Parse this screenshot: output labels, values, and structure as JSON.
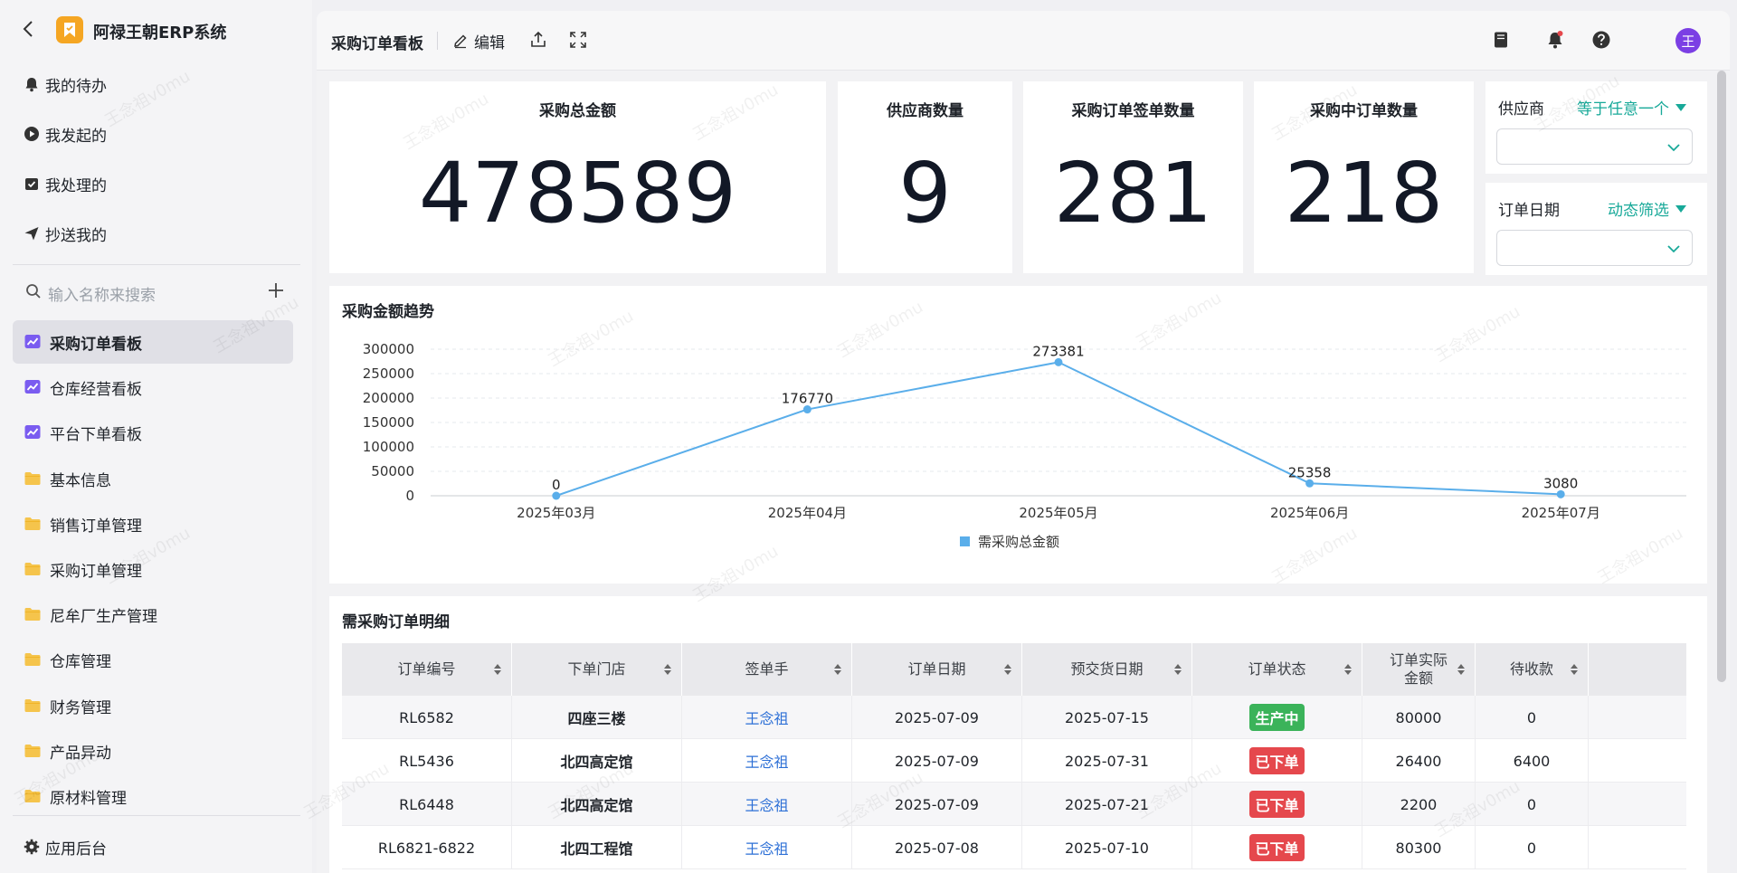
{
  "app": {
    "title": "阿禄王朝ERP系统"
  },
  "sidebar": {
    "quick": [
      {
        "label": "我的待办",
        "icon": "bell-icon"
      },
      {
        "label": "我发起的",
        "icon": "play-circle-icon"
      },
      {
        "label": "我处理的",
        "icon": "check-box-icon"
      },
      {
        "label": "抄送我的",
        "icon": "send-icon"
      }
    ],
    "search_placeholder": "输入名称来搜索",
    "items": [
      {
        "label": "采购订单看板",
        "icon": "dashboard-icon",
        "active": true
      },
      {
        "label": "仓库经营看板",
        "icon": "dashboard-icon"
      },
      {
        "label": "平台下单看板",
        "icon": "dashboard-icon"
      },
      {
        "label": "基本信息",
        "icon": "folder-icon"
      },
      {
        "label": "销售订单管理",
        "icon": "folder-icon"
      },
      {
        "label": "采购订单管理",
        "icon": "folder-icon"
      },
      {
        "label": "尼牟厂生产管理",
        "icon": "folder-icon"
      },
      {
        "label": "仓库管理",
        "icon": "folder-icon"
      },
      {
        "label": "财务管理",
        "icon": "folder-icon"
      },
      {
        "label": "产品异动",
        "icon": "folder-icon"
      },
      {
        "label": "原材料管理",
        "icon": "folder-icon"
      }
    ],
    "admin_label": "应用后台"
  },
  "header": {
    "title": "采购订单看板",
    "edit_label": "编辑",
    "avatar_text": "王"
  },
  "kpis": [
    {
      "label": "采购总金额",
      "value": "478589"
    },
    {
      "label": "供应商数量",
      "value": "9"
    },
    {
      "label": "采购订单签单数量",
      "value": "281"
    },
    {
      "label": "采购中订单数量",
      "value": "218"
    }
  ],
  "filters": [
    {
      "label": "供应商",
      "mode": "等于任意一个"
    },
    {
      "label": "订单日期",
      "mode": "动态筛选"
    }
  ],
  "trend": {
    "title": "采购金额趋势"
  },
  "chart_data": {
    "type": "line",
    "title": "采购金额趋势",
    "categories": [
      "2025年03月",
      "2025年04月",
      "2025年05月",
      "2025年06月",
      "2025年07月"
    ],
    "series": [
      {
        "name": "需采购总金额",
        "values": [
          0,
          176770,
          273381,
          25358,
          3080
        ]
      }
    ],
    "y_ticks": [
      "0",
      "50000",
      "100000",
      "150000",
      "200000",
      "250000",
      "300000"
    ],
    "ylim": [
      0,
      300000
    ],
    "legend": "bottom",
    "grid": true,
    "color": "#5aaeea"
  },
  "table": {
    "title": "需采购订单明细",
    "columns": [
      "订单编号",
      "下单门店",
      "签单手",
      "订单日期",
      "预交货日期",
      "订单状态",
      "订单实际金额",
      "待收款"
    ],
    "rows": [
      {
        "id": "RL6582",
        "store": "四座三楼",
        "signer": "王念祖",
        "date": "2025-07-09",
        "due": "2025-07-15",
        "status": "生产中",
        "status_color": "#3bb35a",
        "amount": "80000",
        "receivable": "0"
      },
      {
        "id": "RL5436",
        "store": "北四高定馆",
        "signer": "王念祖",
        "date": "2025-07-09",
        "due": "2025-07-31",
        "status": "已下单",
        "status_color": "#e5484d",
        "amount": "26400",
        "receivable": "6400"
      },
      {
        "id": "RL6448",
        "store": "北四高定馆",
        "signer": "王念祖",
        "date": "2025-07-09",
        "due": "2025-07-21",
        "status": "已下单",
        "status_color": "#e5484d",
        "amount": "2200",
        "receivable": "0"
      },
      {
        "id": "RL6821-6822",
        "store": "北四工程馆",
        "signer": "王念祖",
        "date": "2025-07-08",
        "due": "2025-07-10",
        "status": "已下单",
        "status_color": "#e5484d",
        "amount": "80300",
        "receivable": "0"
      }
    ]
  },
  "watermark": "王念祖v0mu"
}
